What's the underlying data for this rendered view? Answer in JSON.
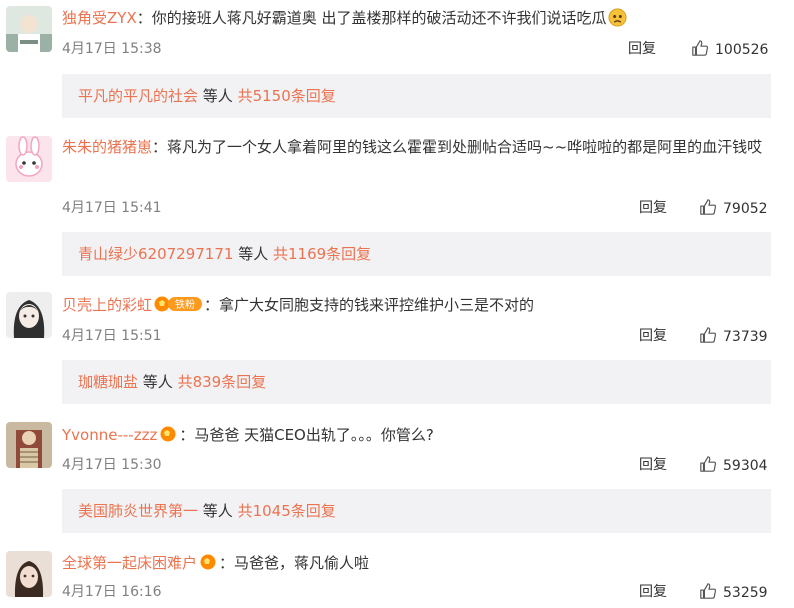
{
  "comments": [
    {
      "username": "独角受ZYX",
      "text": "：你的接班人蒋凡好霸道奥 出了盖楼那样的破活动还不许我们说话吃瓜",
      "emoji": "sad-face-emoji",
      "time": "4月17日 15:38",
      "reply_label": "回复",
      "likes": "100526",
      "replies_user": "平凡的平凡的社会",
      "replies_mid": " 等人 ",
      "replies_count": "共5150条回复"
    },
    {
      "username": "朱朱的猪猪崽",
      "text": "：蒋凡为了一个女人拿着阿里的钱这么霍霍到处删帖合适吗~~哗啦啦的都是阿里的血汗钱哎",
      "time": "4月17日 15:41",
      "reply_label": "回复",
      "likes": "79052",
      "replies_user": "青山绿少6207297171",
      "replies_mid": " 等人 ",
      "replies_count": "共1169条回复"
    },
    {
      "username": "贝壳上的彩虹",
      "badge": "铁粉",
      "text": "：拿广大女同胞支持的钱来评控维护小三是不对的",
      "time": "4月17日 15:51",
      "reply_label": "回复",
      "likes": "73739",
      "replies_user": "珈糖珈盐",
      "replies_mid": " 等人 ",
      "replies_count": "共839条回复"
    },
    {
      "username": "Yvonne---zzz",
      "text": "：马爸爸 天猫CEO出轨了。。。你管么?",
      "time": "4月17日 15:30",
      "reply_label": "回复",
      "likes": "59304",
      "replies_user": "美国肺炎世界第一",
      "replies_mid": " 等人 ",
      "replies_count": "共1045条回复"
    },
    {
      "username": "全球第一起床困难户",
      "text": "：马爸爸，蒋凡偷人啦",
      "time": "4月17日 16:16",
      "reply_label": "回复",
      "likes": "53259"
    }
  ],
  "colors": {
    "username": "#eb7350",
    "text": "#333333",
    "meta": "#808080",
    "reply_box": "#f2f2f5"
  }
}
